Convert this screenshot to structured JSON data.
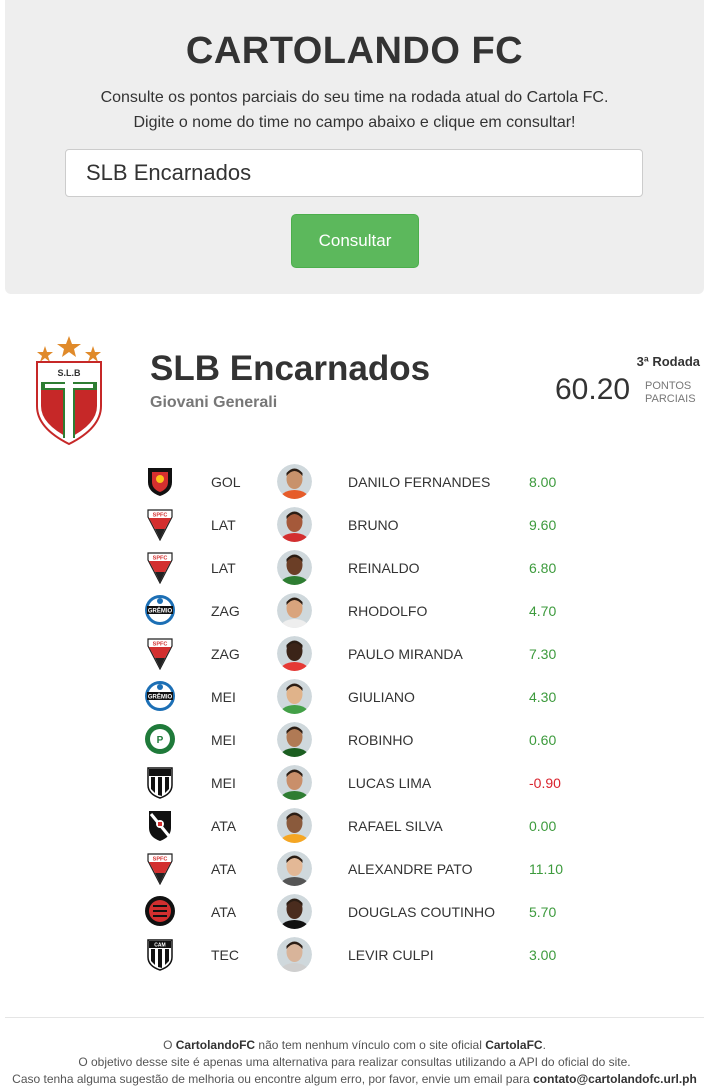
{
  "header": {
    "title": "CARTOLANDO FC",
    "line1": "Consulte os pontos parciais do seu time na rodada atual do Cartola FC.",
    "line2": "Digite o nome do time no campo abaixo e clique em consultar!",
    "input_value": "SLB Encarnados",
    "button_label": "Consultar"
  },
  "team": {
    "crest_text": "S.L.B",
    "name": "SLB Encarnados",
    "owner": "Giovani Generali",
    "round": "3ª Rodada",
    "points": "60.20",
    "points_label_1": "PONTOS",
    "points_label_2": "PARCIAIS"
  },
  "players": [
    {
      "pos": "GOL",
      "name": "DANILO FERNANDES",
      "pts": "8.00",
      "club_icon": "sport-crest-icon"
    },
    {
      "pos": "LAT",
      "name": "BRUNO",
      "pts": "9.60",
      "club_icon": "spfc-crest-icon"
    },
    {
      "pos": "LAT",
      "name": "REINALDO",
      "pts": "6.80",
      "club_icon": "spfc-crest-icon"
    },
    {
      "pos": "ZAG",
      "name": "RHODOLFO",
      "pts": "4.70",
      "club_icon": "gremio-crest-icon"
    },
    {
      "pos": "ZAG",
      "name": "PAULO MIRANDA",
      "pts": "7.30",
      "club_icon": "spfc-crest-icon"
    },
    {
      "pos": "MEI",
      "name": "GIULIANO",
      "pts": "4.30",
      "club_icon": "gremio-crest-icon"
    },
    {
      "pos": "MEI",
      "name": "ROBINHO",
      "pts": "0.60",
      "club_icon": "palmeiras-crest-icon"
    },
    {
      "pos": "MEI",
      "name": "LUCAS LIMA",
      "pts": "-0.90",
      "club_icon": "santos-crest-icon"
    },
    {
      "pos": "ATA",
      "name": "RAFAEL SILVA",
      "pts": "0.00",
      "club_icon": "vasco-crest-icon"
    },
    {
      "pos": "ATA",
      "name": "ALEXANDRE PATO",
      "pts": "11.10",
      "club_icon": "spfc-crest-icon"
    },
    {
      "pos": "ATA",
      "name": "DOUGLAS COUTINHO",
      "pts": "5.70",
      "club_icon": "atletico-pr-crest-icon"
    },
    {
      "pos": "TEC",
      "name": "LEVIR CULPI",
      "pts": "3.00",
      "club_icon": "atletico-mg-crest-icon"
    }
  ],
  "footer": {
    "l1_pre": "O ",
    "l1_brand": "CartolandoFC",
    "l1_mid": " não tem nenhum vínculo com o site oficial ",
    "l1_site": "CartolaFC",
    "l1_end": ".",
    "l2": "O objetivo desse site é apenas uma alternativa para realizar consultas utilizando a API do oficial do site.",
    "l3_pre": "Caso tenha alguma sugestão de melhoria ou encontre algum erro, por favor, envie um email para ",
    "l3_email": "contato@cartolandofc.url.ph"
  },
  "colors": {
    "positive": "#3c9a3c",
    "negative": "#d9232e",
    "button": "#5cb85c",
    "jumbotron": "#eeeeee"
  }
}
